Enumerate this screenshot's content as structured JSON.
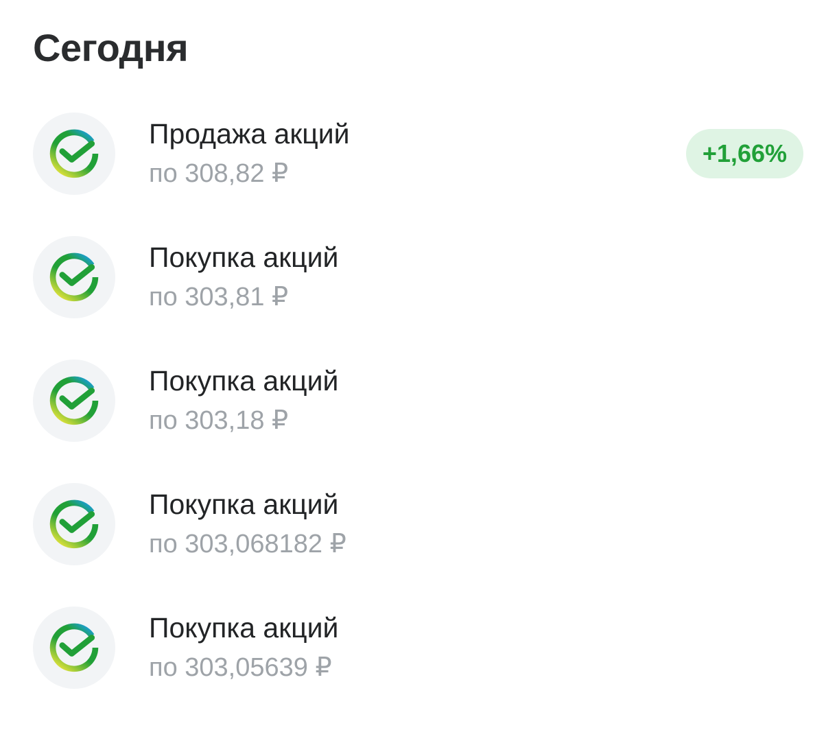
{
  "section": {
    "title": "Сегодня"
  },
  "colors": {
    "badge_background": "#dff4e4",
    "badge_text": "#21a038",
    "logo_green": "#21a038",
    "logo_blue": "#1a9ee0",
    "logo_yellow": "#e6e43a",
    "secondary_text": "#9ea3a8"
  },
  "operations": [
    {
      "icon": "sber-logo-icon",
      "title": "Продажа акций",
      "price": "по 308,82 ₽",
      "badge": "+1,66%"
    },
    {
      "icon": "sber-logo-icon",
      "title": "Покупка акций",
      "price": "по 303,81 ₽"
    },
    {
      "icon": "sber-logo-icon",
      "title": "Покупка акций",
      "price": "по 303,18 ₽"
    },
    {
      "icon": "sber-logo-icon",
      "title": "Покупка акций",
      "price": "по 303,068182 ₽"
    },
    {
      "icon": "sber-logo-icon",
      "title": "Покупка акций",
      "price": "по 303,05639 ₽"
    }
  ]
}
